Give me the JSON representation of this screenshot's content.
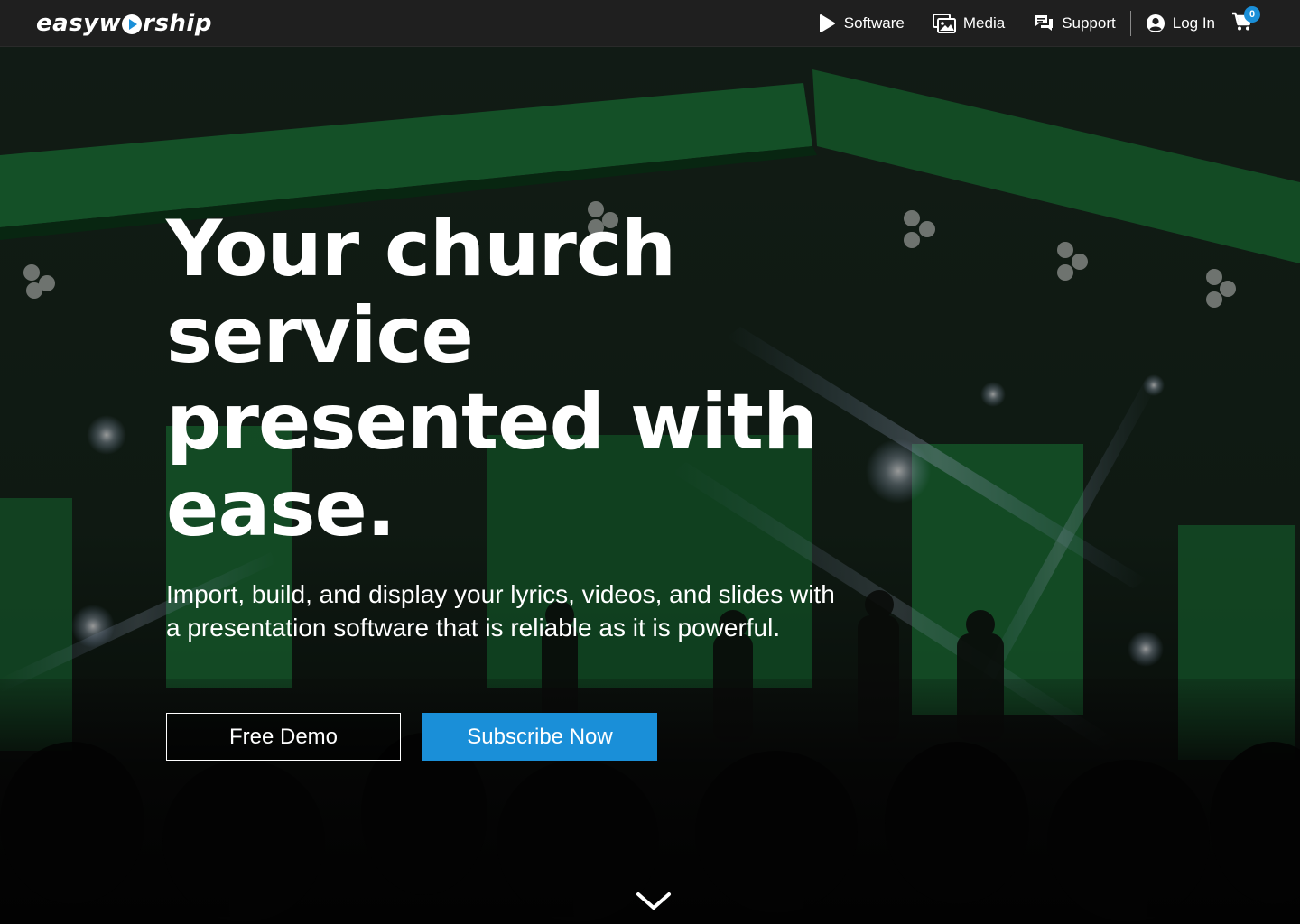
{
  "brand": {
    "logo_text_1": "easyw",
    "logo_text_2": "rship",
    "accent_color": "#1a8fd8"
  },
  "nav": {
    "items": [
      {
        "label": "Software",
        "icon": "play-icon"
      },
      {
        "label": "Media",
        "icon": "images-icon"
      },
      {
        "label": "Support",
        "icon": "chat-icon"
      }
    ],
    "login_label": "Log In",
    "login_icon": "user-circle-icon",
    "cart_icon": "cart-icon",
    "cart_count": "0"
  },
  "hero": {
    "headline": "Your church service presented with ease.",
    "subtext": "Import, build, and display your lyrics, videos, and slides with a presentation software that is reliable as it is powerful.",
    "primary_button": "Free Demo",
    "secondary_button": "Subscribe Now",
    "scroll_icon": "chevron-down-icon",
    "background_description_colors": {
      "screen_green": "#1f7a3c",
      "stage_blue_light": "#6aa0ff"
    }
  }
}
